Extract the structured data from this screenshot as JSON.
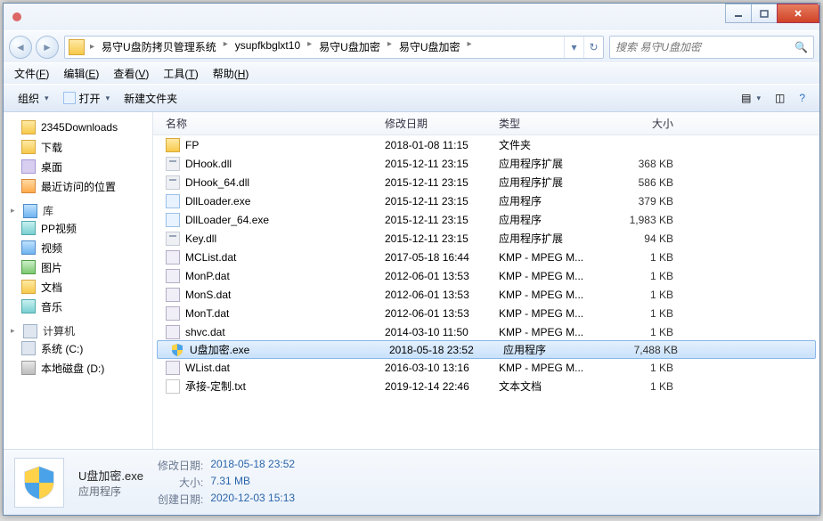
{
  "breadcrumbs": [
    "易守U盘防拷贝管理系统",
    "ysupfkbglxt10",
    "易守U盘加密",
    "易守U盘加密"
  ],
  "search_placeholder": "搜索 易守U盘加密",
  "menus": [
    {
      "l": "文件",
      "k": "F"
    },
    {
      "l": "编辑",
      "k": "E"
    },
    {
      "l": "查看",
      "k": "V"
    },
    {
      "l": "工具",
      "k": "T"
    },
    {
      "l": "帮助",
      "k": "H"
    }
  ],
  "toolbar": {
    "organize": "组织",
    "open": "打开",
    "newfolder": "新建文件夹"
  },
  "sidebar": {
    "top": [
      {
        "label": "2345Downloads",
        "cls": "folder"
      },
      {
        "label": "下载",
        "cls": "folder"
      },
      {
        "label": "桌面",
        "cls": "vio"
      },
      {
        "label": "最近访问的位置",
        "cls": "orng"
      }
    ],
    "lib_head": "库",
    "libs": [
      {
        "label": "PP视频",
        "cls": "cyan"
      },
      {
        "label": "视频",
        "cls": "blue"
      },
      {
        "label": "图片",
        "cls": "green"
      },
      {
        "label": "文档",
        "cls": "folder"
      },
      {
        "label": "音乐",
        "cls": "cyan"
      }
    ],
    "comp_head": "计算机",
    "drives": [
      {
        "label": "系统 (C:)",
        "cls": "mon"
      },
      {
        "label": "本地磁盘 (D:)",
        "cls": "gray"
      }
    ]
  },
  "columns": {
    "name": "名称",
    "date": "修改日期",
    "type": "类型",
    "size": "大小"
  },
  "files": [
    {
      "name": "FP",
      "date": "2018-01-08 11:15",
      "type": "文件夹",
      "size": "",
      "ico": "folder"
    },
    {
      "name": "DHook.dll",
      "date": "2015-12-11 23:15",
      "type": "应用程序扩展",
      "size": "368 KB",
      "ico": "dll"
    },
    {
      "name": "DHook_64.dll",
      "date": "2015-12-11 23:15",
      "type": "应用程序扩展",
      "size": "586 KB",
      "ico": "dll"
    },
    {
      "name": "DllLoader.exe",
      "date": "2015-12-11 23:15",
      "type": "应用程序",
      "size": "379 KB",
      "ico": "exe"
    },
    {
      "name": "DllLoader_64.exe",
      "date": "2015-12-11 23:15",
      "type": "应用程序",
      "size": "1,983 KB",
      "ico": "exe"
    },
    {
      "name": "Key.dll",
      "date": "2015-12-11 23:15",
      "type": "应用程序扩展",
      "size": "94 KB",
      "ico": "dll"
    },
    {
      "name": "MCList.dat",
      "date": "2017-05-18 16:44",
      "type": "KMP - MPEG M...",
      "size": "1 KB",
      "ico": "dat"
    },
    {
      "name": "MonP.dat",
      "date": "2012-06-01 13:53",
      "type": "KMP - MPEG M...",
      "size": "1 KB",
      "ico": "dat"
    },
    {
      "name": "MonS.dat",
      "date": "2012-06-01 13:53",
      "type": "KMP - MPEG M...",
      "size": "1 KB",
      "ico": "dat"
    },
    {
      "name": "MonT.dat",
      "date": "2012-06-01 13:53",
      "type": "KMP - MPEG M...",
      "size": "1 KB",
      "ico": "dat"
    },
    {
      "name": "shvc.dat",
      "date": "2014-03-10 11:50",
      "type": "KMP - MPEG M...",
      "size": "1 KB",
      "ico": "dat"
    },
    {
      "name": "U盘加密.exe",
      "date": "2018-05-18 23:52",
      "type": "应用程序",
      "size": "7,488 KB",
      "ico": "shield",
      "sel": true
    },
    {
      "name": "WList.dat",
      "date": "2016-03-10 13:16",
      "type": "KMP - MPEG M...",
      "size": "1 KB",
      "ico": "dat"
    },
    {
      "name": "承接-定制.txt",
      "date": "2019-12-14 22:46",
      "type": "文本文档",
      "size": "1 KB",
      "ico": "txt"
    }
  ],
  "details": {
    "filename": "U盘加密.exe",
    "filetype": "应用程序",
    "kv": [
      {
        "k": "修改日期:",
        "v": "2018-05-18 23:52"
      },
      {
        "k": "大小:",
        "v": "7.31 MB"
      },
      {
        "k": "创建日期:",
        "v": "2020-12-03 15:13"
      }
    ]
  }
}
